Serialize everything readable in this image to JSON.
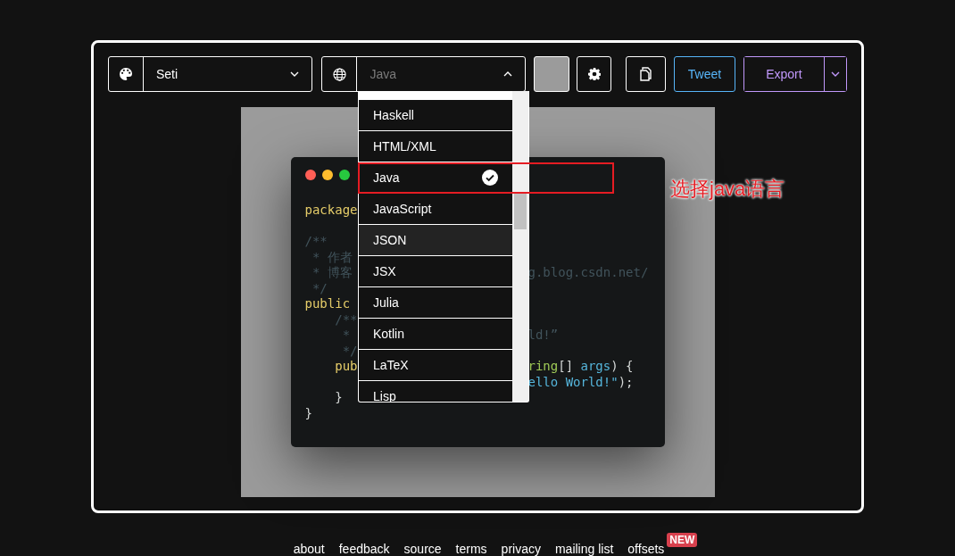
{
  "toolbar": {
    "theme": {
      "value": "Seti"
    },
    "language": {
      "value": "Java",
      "expanded": true
    },
    "tweet": "Tweet",
    "export": "Export"
  },
  "language_menu": {
    "items": [
      {
        "label": "Haskell",
        "selected": false,
        "hovered": false
      },
      {
        "label": "HTML/XML",
        "selected": false,
        "hovered": false
      },
      {
        "label": "Java",
        "selected": true,
        "hovered": false
      },
      {
        "label": "JavaScript",
        "selected": false,
        "hovered": false
      },
      {
        "label": "JSON",
        "selected": false,
        "hovered": true
      },
      {
        "label": "JSX",
        "selected": false,
        "hovered": false
      },
      {
        "label": "Julia",
        "selected": false,
        "hovered": false
      },
      {
        "label": "Kotlin",
        "selected": false,
        "hovered": false
      },
      {
        "label": "LaTeX",
        "selected": false,
        "hovered": false
      },
      {
        "label": "Lisp",
        "selected": false,
        "hovered": false
      }
    ]
  },
  "code_lines": [
    {
      "kind": "code",
      "left": [
        {
          "text": "package",
          "kind": "keyword"
        }
      ]
    },
    {
      "kind": "code",
      "left": [
        {
          "text": "/**",
          "kind": "comment"
        }
      ]
    },
    {
      "kind": "code",
      "left": [
        {
          "text": " * 作者",
          "kind": "comment"
        }
      ]
    },
    {
      "kind": "code",
      "left": [
        {
          "text": " * 博客",
          "kind": "comment"
        }
      ],
      "right": [
        {
          "text": "g.blog.csdn.net/",
          "kind": "comment"
        }
      ]
    },
    {
      "kind": "code",
      "left": [
        {
          "text": " */",
          "kind": "comment"
        }
      ]
    },
    {
      "kind": "code",
      "left": [
        {
          "text": "public",
          "kind": "keyword"
        }
      ]
    },
    {
      "kind": "code",
      "left": [
        {
          "text": "    /**",
          "kind": "comment"
        }
      ]
    },
    {
      "kind": "code",
      "left": [
        {
          "text": "     *",
          "kind": "comment"
        }
      ],
      "right": [
        {
          "text": "ld!”",
          "kind": "comment"
        }
      ]
    },
    {
      "kind": "code",
      "left": [
        {
          "text": "     */",
          "kind": "comment"
        }
      ]
    },
    {
      "kind": "code",
      "left": [
        {
          "text": "    pub",
          "kind": "keyword"
        }
      ],
      "right": [
        {
          "text": "ring",
          "kind": "type"
        },
        {
          "text": "[] ",
          "kind": "plain"
        },
        {
          "text": "args",
          "kind": "string"
        },
        {
          "text": ") {",
          "kind": "plain"
        }
      ]
    },
    {
      "kind": "code",
      "right": [
        {
          "text": "ello World!\"",
          "kind": "string"
        },
        {
          "text": ");",
          "kind": "plain"
        }
      ]
    },
    {
      "kind": "code",
      "left": [
        {
          "text": "    }",
          "kind": "plain"
        }
      ]
    },
    {
      "kind": "code",
      "left": [
        {
          "text": "}",
          "kind": "plain"
        }
      ]
    }
  ],
  "annotation": {
    "text": "选择java语言"
  },
  "footer": {
    "links": [
      "about",
      "feedback",
      "source",
      "terms",
      "privacy",
      "mailing list",
      "offsets"
    ],
    "badge": "NEW"
  }
}
